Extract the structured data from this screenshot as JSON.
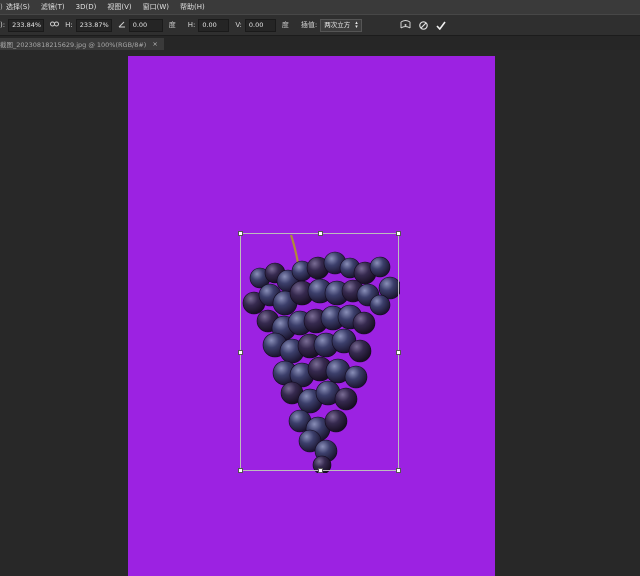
{
  "menubar": {
    "items": [
      "选择(S)",
      "滤镜(T)",
      "3D(D)",
      "视图(V)",
      "窗口(W)",
      "帮助(H)"
    ]
  },
  "options": {
    "w_label": "W:",
    "w_value": "233.84%",
    "link_icon": "link-icon",
    "h_label": "H:",
    "h_value": "233.87%",
    "angle_value": "0.00",
    "angle_unit": "度",
    "hskew_label": "H:",
    "hskew_value": "0.00",
    "hskew_unit": "度",
    "vskew_label": "V:",
    "vskew_value": "0.00",
    "vskew_unit": "度",
    "interp_label": "插值:",
    "interp_value": "两次立方"
  },
  "document_tab": {
    "title": "截图_20230818215629.jpg @ 100%(RGB/8#)",
    "close": "×"
  },
  "colors": {
    "canvas_bg": "#9c22e2",
    "workspace_bg": "#282828"
  }
}
